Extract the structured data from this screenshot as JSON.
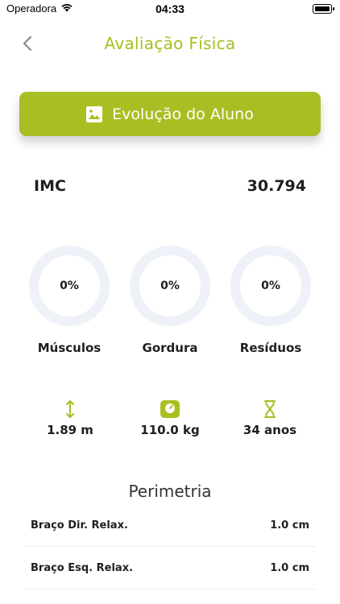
{
  "status_bar": {
    "carrier": "Operadora",
    "time": "04:33"
  },
  "header": {
    "title": "Avaliação Física"
  },
  "evolution_button": {
    "label": "Evolução do Aluno"
  },
  "imc": {
    "label": "IMC",
    "value": "30.794"
  },
  "composition": [
    {
      "value": "0%",
      "label": "Músculos"
    },
    {
      "value": "0%",
      "label": "Gordura"
    },
    {
      "value": "0%",
      "label": "Resíduos"
    }
  ],
  "measures": [
    {
      "icon": "height-arrows-icon",
      "value": "1.89 m"
    },
    {
      "icon": "scale-icon",
      "value": "110.0 kg"
    },
    {
      "icon": "hourglass-icon",
      "value": "34 anos"
    }
  ],
  "perimetria": {
    "title": "Perimetria",
    "rows": [
      {
        "label": "Braço Dir. Relax.",
        "value": "1.0 cm"
      },
      {
        "label": "Braço Esq. Relax.",
        "value": "1.0 cm"
      }
    ]
  },
  "colors": {
    "accent": "#a9be22",
    "ring": "#eef1f8",
    "text": "#1f1f1f"
  }
}
